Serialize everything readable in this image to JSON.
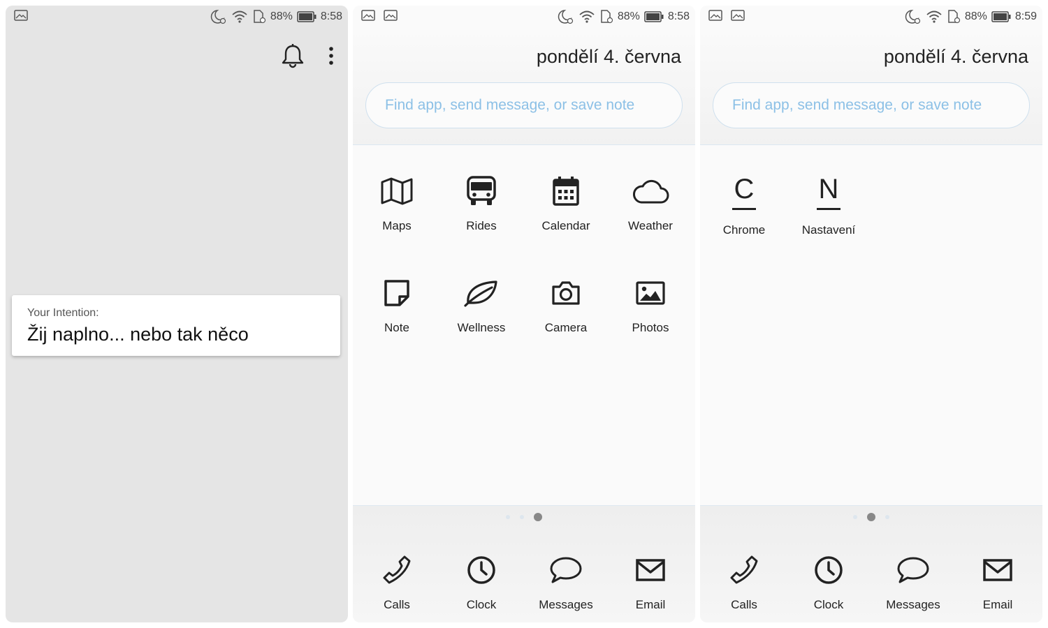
{
  "screens": [
    {
      "status": {
        "battery": "88%",
        "time": "8:58"
      },
      "intention": {
        "label": "Your Intention:",
        "value": "Žij naplno... nebo tak něco"
      }
    },
    {
      "status": {
        "battery": "88%",
        "time": "8:58"
      },
      "date": "pondělí 4. června",
      "search": {
        "placeholder": "Find app, send message, or save note"
      },
      "apps": [
        {
          "label": "Maps",
          "icon": "map-icon"
        },
        {
          "label": "Rides",
          "icon": "bus-icon"
        },
        {
          "label": "Calendar",
          "icon": "calendar-icon"
        },
        {
          "label": "Weather",
          "icon": "cloud-icon"
        },
        {
          "label": "Note",
          "icon": "note-icon"
        },
        {
          "label": "Wellness",
          "icon": "leaf-icon"
        },
        {
          "label": "Camera",
          "icon": "camera-icon"
        },
        {
          "label": "Photos",
          "icon": "image-icon"
        }
      ],
      "page_dots": {
        "count": 3,
        "active": 2
      },
      "dock": [
        {
          "label": "Calls",
          "icon": "phone-icon"
        },
        {
          "label": "Clock",
          "icon": "clock-icon"
        },
        {
          "label": "Messages",
          "icon": "chat-bubble-icon"
        },
        {
          "label": "Email",
          "icon": "envelope-icon"
        }
      ]
    },
    {
      "status": {
        "battery": "88%",
        "time": "8:59"
      },
      "date": "pondělí 4. června",
      "search": {
        "placeholder": "Find app, send message, or save note"
      },
      "apps": [
        {
          "letter": "C",
          "label": "Chrome"
        },
        {
          "letter": "N",
          "label": "Nastavení"
        }
      ],
      "page_dots": {
        "count": 3,
        "active": 1
      },
      "dock": [
        {
          "label": "Calls",
          "icon": "phone-icon"
        },
        {
          "label": "Clock",
          "icon": "clock-icon"
        },
        {
          "label": "Messages",
          "icon": "chat-bubble-icon"
        },
        {
          "label": "Email",
          "icon": "envelope-icon"
        }
      ]
    }
  ],
  "colors": {
    "placeholder": "#8cc0e6",
    "search_border": "#cfe0ee",
    "screen1_bg": "#e5e5e5",
    "launcher_bg": "#fafafa",
    "active_dot": "#888888"
  }
}
